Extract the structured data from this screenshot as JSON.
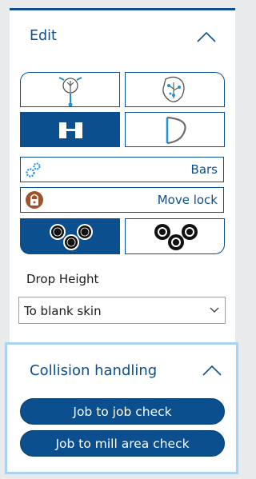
{
  "edit": {
    "title": "Edit",
    "collapse_icon": "chevron-up-icon",
    "tool_buttons": [
      {
        "icon": "tree-pin-icon",
        "selected": false
      },
      {
        "icon": "tree-nodes-icon",
        "selected": false
      },
      {
        "icon": "bracket-pair-icon",
        "selected": true
      },
      {
        "icon": "arc-shape-icon",
        "selected": false
      }
    ],
    "bars_label": "Bars",
    "bars_icon": "gears-icon",
    "move_lock_label": "Move lock",
    "move_lock_icon": "lock-icon",
    "pattern_buttons": [
      {
        "icon": "three-circles-icon",
        "selected": true
      },
      {
        "icon": "three-circles-icon",
        "selected": false
      }
    ],
    "drop_height_label": "Drop Height",
    "drop_height_value": "To blank skin"
  },
  "collision": {
    "title": "Collision handling",
    "job_to_job_label": "Job to job check",
    "job_to_mill_label": "Job to mill area check"
  },
  "colors": {
    "accent": "#0b4f8f",
    "highlight_border": "#a8d4f2",
    "lock_badge": "#a0522d"
  }
}
